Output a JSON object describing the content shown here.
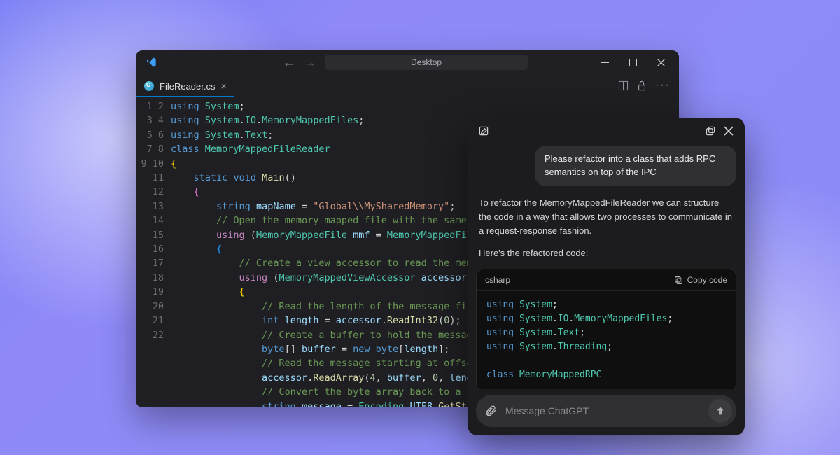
{
  "vscode": {
    "breadcrumb": "Desktop",
    "tab": {
      "filename": "FileReader.cs"
    },
    "code_lines": [
      [
        [
          "kw",
          "using"
        ],
        [
          "op",
          " "
        ],
        [
          "cls",
          "System"
        ],
        [
          "op",
          ";"
        ]
      ],
      [
        [
          "kw",
          "using"
        ],
        [
          "op",
          " "
        ],
        [
          "cls",
          "System"
        ],
        [
          "op",
          "."
        ],
        [
          "cls",
          "IO"
        ],
        [
          "op",
          "."
        ],
        [
          "cls",
          "MemoryMappedFiles"
        ],
        [
          "op",
          ";"
        ]
      ],
      [
        [
          "kw",
          "using"
        ],
        [
          "op",
          " "
        ],
        [
          "cls",
          "System"
        ],
        [
          "op",
          "."
        ],
        [
          "cls",
          "Text"
        ],
        [
          "op",
          ";"
        ]
      ],
      [
        [
          "kw",
          "class"
        ],
        [
          "op",
          " "
        ],
        [
          "cls",
          "MemoryMappedFileReader"
        ]
      ],
      [
        [
          "brace-y",
          "{"
        ]
      ],
      [
        [
          "op",
          "    "
        ],
        [
          "kw",
          "static"
        ],
        [
          "op",
          " "
        ],
        [
          "kw",
          "void"
        ],
        [
          "op",
          " "
        ],
        [
          "fn",
          "Main"
        ],
        [
          "op",
          "()"
        ]
      ],
      [
        [
          "op",
          "    "
        ],
        [
          "brace-p",
          "{"
        ]
      ],
      [
        [
          "op",
          "        "
        ],
        [
          "kw",
          "string"
        ],
        [
          "op",
          " "
        ],
        [
          "var",
          "mapName"
        ],
        [
          "op",
          " = "
        ],
        [
          "str",
          "\"Global\\\\MySharedMemory\""
        ],
        [
          "op",
          ";"
        ]
      ],
      [
        [
          "op",
          "        "
        ],
        [
          "cm",
          "// Open the memory-mapped file with the same na"
        ]
      ],
      [
        [
          "op",
          "        "
        ],
        [
          "kw2",
          "using"
        ],
        [
          "op",
          " ("
        ],
        [
          "cls",
          "MemoryMappedFile"
        ],
        [
          "op",
          " "
        ],
        [
          "var",
          "mmf"
        ],
        [
          "op",
          " = "
        ],
        [
          "cls",
          "MemoryMappedFile"
        ],
        [
          "op",
          "."
        ]
      ],
      [
        [
          "op",
          "        "
        ],
        [
          "brace-b",
          "{"
        ]
      ],
      [
        [
          "op",
          "            "
        ],
        [
          "cm",
          "// Create a view accessor to read the memor"
        ]
      ],
      [
        [
          "op",
          "            "
        ],
        [
          "kw2",
          "using"
        ],
        [
          "op",
          " ("
        ],
        [
          "cls",
          "MemoryMappedViewAccessor"
        ],
        [
          "op",
          " "
        ],
        [
          "var",
          "accessor"
        ],
        [
          "op",
          " = "
        ]
      ],
      [
        [
          "op",
          "            "
        ],
        [
          "brace-y",
          "{"
        ]
      ],
      [
        [
          "op",
          "                "
        ],
        [
          "cm",
          "// Read the length of the message first"
        ]
      ],
      [
        [
          "op",
          "                "
        ],
        [
          "kw",
          "int"
        ],
        [
          "op",
          " "
        ],
        [
          "var",
          "length"
        ],
        [
          "op",
          " = "
        ],
        [
          "var",
          "accessor"
        ],
        [
          "op",
          "."
        ],
        [
          "fn",
          "ReadInt32"
        ],
        [
          "op",
          "("
        ],
        [
          "num",
          "0"
        ],
        [
          "op",
          ");"
        ]
      ],
      [
        [
          "op",
          "                "
        ],
        [
          "cm",
          "// Create a buffer to hold the message "
        ]
      ],
      [
        [
          "op",
          "                "
        ],
        [
          "kw",
          "byte"
        ],
        [
          "op",
          "[] "
        ],
        [
          "var",
          "buffer"
        ],
        [
          "op",
          " = "
        ],
        [
          "kw",
          "new"
        ],
        [
          "op",
          " "
        ],
        [
          "kw",
          "byte"
        ],
        [
          "op",
          "["
        ],
        [
          "var",
          "length"
        ],
        [
          "op",
          "];"
        ]
      ],
      [
        [
          "op",
          "                "
        ],
        [
          "cm",
          "// Read the message starting at offset "
        ]
      ],
      [
        [
          "op",
          "                "
        ],
        [
          "var",
          "accessor"
        ],
        [
          "op",
          "."
        ],
        [
          "fn",
          "ReadArray"
        ],
        [
          "op",
          "("
        ],
        [
          "num",
          "4"
        ],
        [
          "op",
          ", "
        ],
        [
          "var",
          "buffer"
        ],
        [
          "op",
          ", "
        ],
        [
          "num",
          "0"
        ],
        [
          "op",
          ", "
        ],
        [
          "var",
          "length"
        ]
      ],
      [
        [
          "op",
          "                "
        ],
        [
          "cm",
          "// Convert the byte array back to a str"
        ]
      ],
      [
        [
          "op",
          "                "
        ],
        [
          "kw",
          "string"
        ],
        [
          "op",
          " "
        ],
        [
          "var",
          "message"
        ],
        [
          "op",
          " = "
        ],
        [
          "cls",
          "Encoding"
        ],
        [
          "op",
          "."
        ],
        [
          "var",
          "UTF8"
        ],
        [
          "op",
          "."
        ],
        [
          "fn",
          "GetStrin"
        ]
      ]
    ]
  },
  "chat": {
    "user_message": "Please refactor into a class that adds RPC semantics on top of the IPC",
    "assistant_p1": "To refactor the MemoryMappedFileReader we can structure the code in a way that allows two processes to communicate in a request-response fashion.",
    "assistant_p2": "Here's the refactored code:",
    "code_lang": "csharp",
    "copy_label": "Copy code",
    "code_lines": [
      [
        [
          "kw",
          "using"
        ],
        [
          "op",
          " "
        ],
        [
          "cls",
          "System"
        ],
        [
          "op",
          ";"
        ]
      ],
      [
        [
          "kw",
          "using"
        ],
        [
          "op",
          " "
        ],
        [
          "cls",
          "System"
        ],
        [
          "op",
          "."
        ],
        [
          "cls",
          "IO"
        ],
        [
          "op",
          "."
        ],
        [
          "cls",
          "MemoryMappedFiles"
        ],
        [
          "op",
          ";"
        ]
      ],
      [
        [
          "kw",
          "using"
        ],
        [
          "op",
          " "
        ],
        [
          "cls",
          "System"
        ],
        [
          "op",
          "."
        ],
        [
          "cls",
          "Text"
        ],
        [
          "op",
          ";"
        ]
      ],
      [
        [
          "kw",
          "using"
        ],
        [
          "op",
          " "
        ],
        [
          "cls",
          "System"
        ],
        [
          "op",
          "."
        ],
        [
          "cls",
          "Threading"
        ],
        [
          "op",
          ";"
        ]
      ],
      [],
      [
        [
          "kw",
          "class"
        ],
        [
          "op",
          " "
        ],
        [
          "cls",
          "MemoryMappedRPC"
        ]
      ]
    ],
    "input_placeholder": "Message ChatGPT"
  }
}
